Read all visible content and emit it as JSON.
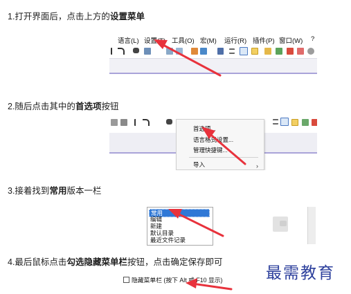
{
  "steps": [
    {
      "pre": "1.打开界面后，点击上方的",
      "bold": "设置菜单",
      "post": ""
    },
    {
      "pre": "2.随后点击其中的",
      "bold": "首选项",
      "post": "按钮"
    },
    {
      "pre": "3.接着找到",
      "bold": "常用",
      "post": "版本一栏"
    },
    {
      "pre": "4.最后鼠标点击",
      "bold": "勾选隐藏菜单栏",
      "post": "按钮，点击确定保存即可"
    }
  ],
  "menubar": {
    "items": [
      "语言(L)",
      "设置(T)",
      "工具(O)",
      "宏(M)",
      "运行(R)",
      "插件(P)",
      "窗口(W)",
      "?"
    ]
  },
  "dropdown": {
    "items": [
      "首选项...",
      "语言格式设置...",
      "管理快捷键..."
    ],
    "submenu": "导入",
    "submenu_arrow": "›"
  },
  "list": {
    "items": [
      "常用",
      "编辑",
      "新建",
      "默认目录",
      "最近文件记录"
    ]
  },
  "checkbox": {
    "label": "隐藏菜单栏 (按下 Alt 或 F10 显示)",
    "checked": false
  },
  "watermark": "最需教育",
  "colors": {
    "arrow": "#e8323c",
    "selection": "#2f78d6",
    "watermark": "#2c3f9c",
    "accent_line": "#a9a3d9"
  }
}
